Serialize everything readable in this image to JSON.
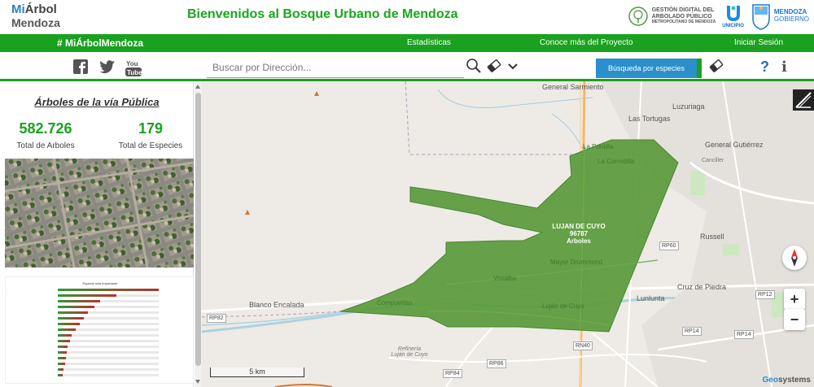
{
  "header": {
    "logo_mi": "Mi",
    "logo_arbol": "Árbol",
    "logo_city": "Mendoza",
    "welcome": "Bienvenidos al Bosque Urbano de Mendoza",
    "gestion_line1": "GESTIÓN DIGITAL DEL",
    "gestion_line2": "ARBOLADO PÚBLICO",
    "gestion_line3": "METROPOLITANO DE MENDOZA",
    "unicipio": "UNICIPIO",
    "mendoza_line1": "MENDOZA",
    "mendoza_line2": "GOBIERNO"
  },
  "nav": {
    "brand": "# MiÁrbolMendoza",
    "links": [
      "Estadísticas",
      "Conoce más del Proyecto",
      "Iniciar Sesión"
    ]
  },
  "toolbar": {
    "social_icons": [
      "facebook-icon",
      "twitter-icon",
      "youtube-icon"
    ],
    "search_placeholder": "Buscar por Dirección...",
    "species_button": "Búsqueda por especies",
    "help": "?",
    "info": "i"
  },
  "sidebar": {
    "title": "Árboles de la vía Pública",
    "total_trees": "582.726",
    "total_trees_label": "Total de Arboles",
    "total_species": "179",
    "total_species_label": "Total de Especies",
    "chart_title": "Especie más importante"
  },
  "map": {
    "labels": [
      "General Sarmiento",
      "Luzuriaga",
      "Las Tortugas",
      "General Gutiérrez",
      "Canciller",
      "La Carrodilla",
      "La Puntilla",
      "Russell",
      "Mayor Drummond",
      "Vistalba",
      "Luján de Cuyo",
      "Compuertas",
      "Cruz de Piedra",
      "Lunlunta",
      "Blanco Encalada",
      "Refinería Luján de Cuyo"
    ],
    "routes": [
      "RP60",
      "RP12",
      "RP14",
      "RP14",
      "RP82",
      "RN40",
      "RP84",
      "RP86"
    ],
    "polygon_line1": "LUJAN DE CUYO",
    "polygon_line2": "96787",
    "polygon_line3": "Arboles",
    "polygon_color": "#5a9a3c",
    "scale": "5 km",
    "attribution_g": "Geo",
    "attribution_rest": "systems",
    "zoom_in": "+",
    "zoom_out": "−"
  },
  "colors": {
    "brand_green": "#1aa11f",
    "accent_blue": "#2a8fcb"
  }
}
